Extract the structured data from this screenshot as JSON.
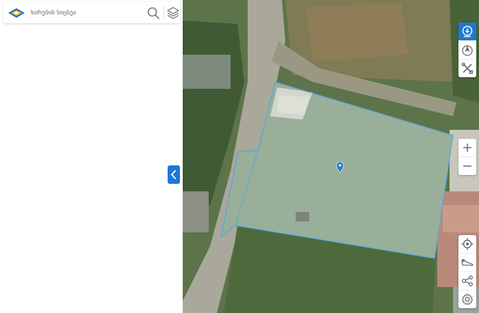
{
  "search": {
    "placeholder": "ხარების სიცსეა"
  },
  "icons": {
    "logo": "diamond-logo-icon",
    "search": "search-icon",
    "layers": "layers-icon",
    "collapse": "chevron-left-icon",
    "download": "download-icon",
    "north": "compass-north-icon",
    "tools": "tools-icon",
    "zoom_in": "plus-icon",
    "zoom_out": "minus-icon",
    "locate": "locate-icon",
    "cadastral": "cadastral-icon",
    "share": "share-icon",
    "settings": "gear-icon"
  },
  "colors": {
    "accent": "#1f78d1",
    "parcel_outline": "#4ea7e8",
    "marker": "#1f78d1"
  }
}
